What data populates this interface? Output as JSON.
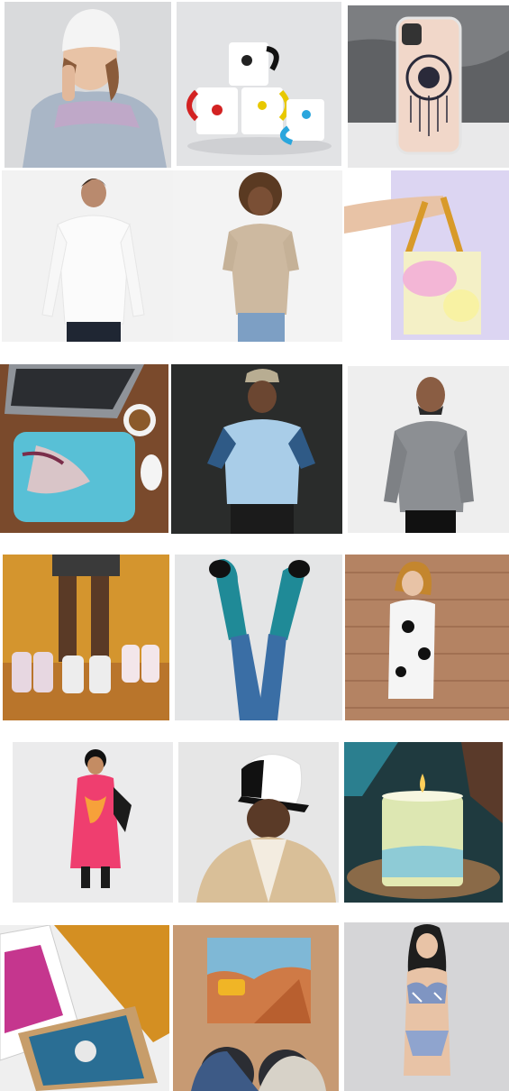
{
  "grid": {
    "rows": [
      {
        "tiles": [
          {
            "name": "beanie",
            "icon": "beanie-model-photo",
            "bg": "#d9dadc"
          },
          {
            "name": "mugs",
            "icon": "color-mugs-photo",
            "bg": "#e2e3e5"
          },
          {
            "name": "phone-case",
            "icon": "phone-case-photo",
            "bg": "#6e7073"
          }
        ]
      },
      {
        "tiles": [
          {
            "name": "long-sleeve-shirt",
            "icon": "long-sleeve-shirt-photo",
            "bg": "#f2f2f2"
          },
          {
            "name": "t-shirt",
            "icon": "t-shirt-photo",
            "bg": "#f3f3f3"
          },
          {
            "name": "tote-bag",
            "icon": "tote-bag-photo",
            "bg": "#e7e2f2"
          }
        ]
      },
      {
        "tiles": [
          {
            "name": "laptop-sleeve",
            "icon": "laptop-sleeve-photo",
            "bg": "#7a4a2c"
          },
          {
            "name": "sports-jersey",
            "icon": "sports-jersey-photo",
            "bg": "#2a2c2b"
          },
          {
            "name": "hoodie",
            "icon": "hoodie-photo",
            "bg": "#eeeeee"
          }
        ]
      },
      {
        "tiles": [
          {
            "name": "sneakers",
            "icon": "sneakers-photo",
            "bg": "#d4952e"
          },
          {
            "name": "socks",
            "icon": "socks-photo",
            "bg": "#e4e5e6"
          },
          {
            "name": "dress",
            "icon": "dress-photo",
            "bg": "#a57354"
          }
        ]
      },
      {
        "tiles": [
          {
            "name": "midi-dress",
            "icon": "midi-dress-photo",
            "bg": "#ebebec"
          },
          {
            "name": "trucker-hat",
            "icon": "trucker-hat-photo",
            "bg": "#e6e6e6"
          },
          {
            "name": "candle",
            "icon": "candle-photo",
            "bg": "#1f3a3f"
          }
        ]
      },
      {
        "tiles": [
          {
            "name": "framed-poster",
            "icon": "framed-poster-photo",
            "bg": "#efefef"
          },
          {
            "name": "jigsaw-puzzle",
            "icon": "jigsaw-puzzle-photo",
            "bg": "#c79a73"
          },
          {
            "name": "bikini",
            "icon": "bikini-photo",
            "bg": "#d5d5d7"
          }
        ]
      }
    ]
  },
  "colors": {
    "page_bg": "#ffffff",
    "skin_light": "#e8c3a6",
    "skin_dark": "#6b4631",
    "denim": "#3c5f8a"
  }
}
